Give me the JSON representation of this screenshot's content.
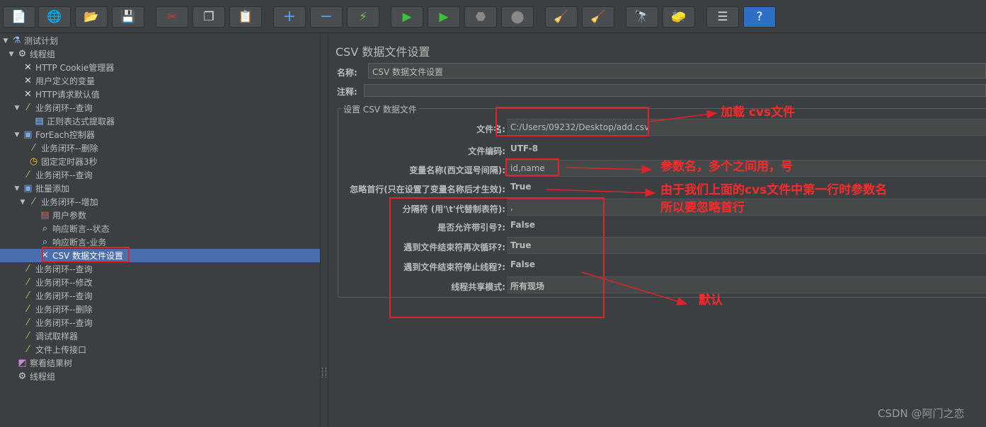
{
  "toolbar": {
    "buttons": [
      {
        "name": "new-icon",
        "glyph": "📄"
      },
      {
        "name": "templates-icon",
        "glyph": "🌐"
      },
      {
        "name": "open-icon",
        "glyph": "📂"
      },
      {
        "name": "save-icon",
        "glyph": "💾"
      },
      {
        "name": "cut-icon",
        "glyph": "✂"
      },
      {
        "name": "copy-icon",
        "glyph": "❐"
      },
      {
        "name": "paste-icon",
        "glyph": "📋"
      },
      {
        "name": "expand-icon",
        "glyph": "+"
      },
      {
        "name": "collapse-icon",
        "glyph": "−"
      },
      {
        "name": "toggle-icon",
        "glyph": "⚡"
      },
      {
        "name": "start-icon",
        "glyph": "▶"
      },
      {
        "name": "start-no-pause-icon",
        "glyph": "▶"
      },
      {
        "name": "stop-icon",
        "glyph": "⬣"
      },
      {
        "name": "shutdown-icon",
        "glyph": "⬤"
      },
      {
        "name": "clear-icon",
        "glyph": "🧹"
      },
      {
        "name": "clear-all-icon",
        "glyph": "🧹"
      },
      {
        "name": "search-icon",
        "glyph": "🔭"
      },
      {
        "name": "reset-search-icon",
        "glyph": "🧽"
      },
      {
        "name": "function-helper-icon",
        "glyph": "☰"
      },
      {
        "name": "help-icon",
        "glyph": "?"
      }
    ]
  },
  "tree": {
    "items": [
      {
        "label": "测试计划",
        "icon": "flask-icon",
        "glyph": "⚗",
        "arrow": "▼"
      },
      {
        "label": "线程组",
        "icon": "gear-icon",
        "glyph": "⚙",
        "arrow": "▼"
      },
      {
        "label": "HTTP Cookie管理器",
        "icon": "wrench-icon",
        "glyph": "✕",
        "arrow": ""
      },
      {
        "label": "用户定义的变量",
        "icon": "wrench-icon",
        "glyph": "✕",
        "arrow": ""
      },
      {
        "label": "HTTP请求默认值",
        "icon": "wrench-icon",
        "glyph": "✕",
        "arrow": ""
      },
      {
        "label": "业务闭环--查询",
        "icon": "pipette-icon",
        "glyph": "⁄",
        "arrow": "▼"
      },
      {
        "label": "正则表达式提取器",
        "icon": "doc-icon",
        "glyph": "▤",
        "arrow": ""
      },
      {
        "label": "ForEach控制器",
        "icon": "controller-icon",
        "glyph": "▣",
        "arrow": "▼"
      },
      {
        "label": "业务闭环--删除",
        "icon": "pipette-icon",
        "glyph": "⁄",
        "arrow": ""
      },
      {
        "label": "固定定时器3秒",
        "icon": "clock-icon",
        "glyph": "◷",
        "arrow": ""
      },
      {
        "label": "业务闭环--查询",
        "icon": "pipette-icon",
        "glyph": "⁄",
        "arrow": ""
      },
      {
        "label": "批量添加",
        "icon": "controller-icon",
        "glyph": "▣",
        "arrow": "▼"
      },
      {
        "label": "业务闭环--增加",
        "icon": "pipette-icon",
        "glyph": "⁄",
        "arrow": "▼"
      },
      {
        "label": "用户参数",
        "icon": "preprocessor-icon",
        "glyph": "▤",
        "arrow": ""
      },
      {
        "label": "响应断言--状态",
        "icon": "magnifier-icon",
        "glyph": "⌕",
        "arrow": ""
      },
      {
        "label": "响应断言-业务",
        "icon": "magnifier-icon",
        "glyph": "⌕",
        "arrow": ""
      },
      {
        "label": "CSV 数据文件设置",
        "icon": "wrench-icon",
        "glyph": "✕",
        "arrow": ""
      },
      {
        "label": "业务闭环--查询",
        "icon": "pipette-icon",
        "glyph": "⁄",
        "arrow": ""
      },
      {
        "label": "业务闭环--修改",
        "icon": "pipette-icon",
        "glyph": "⁄",
        "arrow": ""
      },
      {
        "label": "业务闭环--查询",
        "icon": "pipette-icon",
        "glyph": "⁄",
        "arrow": ""
      },
      {
        "label": "业务闭环--删除",
        "icon": "pipette-icon",
        "glyph": "⁄",
        "arrow": ""
      },
      {
        "label": "业务闭环--查询",
        "icon": "pipette-icon",
        "glyph": "⁄",
        "arrow": ""
      },
      {
        "label": "调试取样器",
        "icon": "pipette-icon",
        "glyph": "⁄",
        "arrow": ""
      },
      {
        "label": "文件上传接口",
        "icon": "pipette-icon",
        "glyph": "⁄",
        "arrow": ""
      },
      {
        "label": "察看结果树",
        "icon": "chart-icon",
        "glyph": "◩",
        "arrow": ""
      },
      {
        "label": "线程组",
        "icon": "gear-icon",
        "glyph": "⚙",
        "arrow": ""
      }
    ]
  },
  "panel": {
    "title": "CSV 数据文件设置",
    "name_label": "名称:",
    "name_value": "CSV 数据文件设置",
    "comment_label": "注释:",
    "comment_value": "",
    "group_title": "设置 CSV 数据文件",
    "rows": [
      {
        "label": "文件名:",
        "value": "C:/Users/09232/Desktop/add.csv"
      },
      {
        "label": "文件编码:",
        "value": "UTF-8"
      },
      {
        "label": "变量名称(西文逗号间隔):",
        "value": "id,name"
      },
      {
        "label": "忽略首行(只在设置了变量名称后才生效):",
        "value": "True"
      },
      {
        "label": "分隔符 (用'\\t'代替制表符):",
        "value": ","
      },
      {
        "label": "是否允许带引号?:",
        "value": "False"
      },
      {
        "label": "遇到文件结束符再次循环?:",
        "value": "True"
      },
      {
        "label": "遇到文件结束符停止线程?:",
        "value": "False"
      },
      {
        "label": "线程共享模式:",
        "value": "所有现场"
      }
    ]
  },
  "annotations": {
    "load_csv": "加载 cvs文件",
    "param_names": "参数名，多个之间用，号",
    "ignore_line1": "由于我们上面的cvs文件中第一行时参数名",
    "ignore_line2": "所以要忽略首行",
    "defaults": "默认",
    "color": "#e0222a"
  },
  "watermark": "CSDN @阿门之恋"
}
